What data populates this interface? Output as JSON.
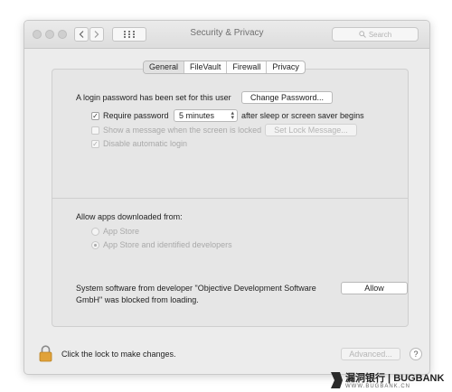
{
  "window": {
    "title": "Security & Privacy"
  },
  "search": {
    "placeholder": "Search",
    "icon": "magnifier"
  },
  "tabs": [
    {
      "label": "General",
      "active": true
    },
    {
      "label": "FileVault",
      "active": false
    },
    {
      "label": "Firewall",
      "active": false
    },
    {
      "label": "Privacy",
      "active": false
    }
  ],
  "general": {
    "login_password_text": "A login password has been set for this user",
    "change_password_label": "Change Password...",
    "require_password": {
      "label": "Require password",
      "checked": true,
      "select_value": "5 minutes",
      "suffix": "after sleep or screen saver begins"
    },
    "show_message": {
      "label": "Show a message when the screen is locked",
      "checked": false,
      "enabled": false,
      "button_label": "Set Lock Message..."
    },
    "disable_autologin": {
      "label": "Disable automatic login",
      "checked": true,
      "enabled": false
    }
  },
  "apps": {
    "heading": "Allow apps downloaded from:",
    "options": [
      {
        "label": "App Store",
        "selected": false
      },
      {
        "label": "App Store and identified developers",
        "selected": true
      }
    ]
  },
  "blocked": {
    "message_line1": "System software from developer \"Objective Development Software",
    "message_line2": "GmbH\" was blocked from loading.",
    "allow_label": "Allow"
  },
  "footer": {
    "lock_text": "Click the lock to make changes.",
    "advanced_label": "Advanced...",
    "help_label": "?"
  },
  "watermark": {
    "top": "漏洞银行 | BUGBANK",
    "bottom": "WWW.BUGBANK.CN"
  },
  "colors": {
    "window_bg": "#ececec",
    "lock": "#e0a23a"
  }
}
